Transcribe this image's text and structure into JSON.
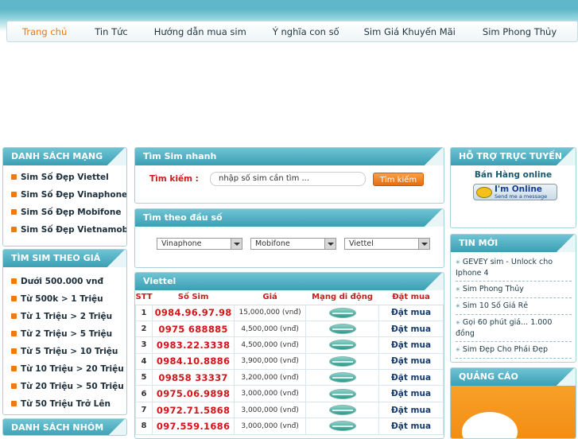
{
  "nav": {
    "items": [
      "Trang chủ",
      "Tin Tức",
      "Hướng dẫn mua sim",
      "Ý nghĩa con số",
      "Sim Giá Khuyến Mãi",
      "Sim Phong Thủy"
    ]
  },
  "left": {
    "networks_title": "DANH SÁCH MẠNG",
    "networks": [
      "Sim Số Đẹp Viettel",
      "Sim Số Đẹp Vinaphone",
      "Sim Số Đẹp Mobifone",
      "Sim Số Đẹp Vietnamobile"
    ],
    "price_title": "TÌM SIM THEO GIÁ",
    "prices": [
      "Dưới 500.000 vnđ",
      "Từ 500k > 1 Triệu",
      "Từ 1 Triệu > 2 Triệu",
      "Từ 2 Triệu > 5 Triệu",
      "Từ 5 Triệu > 10 Triệu",
      "Từ 10 Triệu > 20 Triệu",
      "Từ 20 Triệu > 50 Triệu",
      "Từ 50 Triệu Trở Lên"
    ],
    "group_title": "DANH SÁCH NHÓM"
  },
  "search": {
    "title": "Tìm Sim nhanh",
    "label": "Tìm kiếm :",
    "placeholder": "nhập số sim cần tìm ...",
    "button": "Tìm kiếm"
  },
  "prefix": {
    "title": "Tìm theo đầu số",
    "selects": [
      "Vinaphone",
      "Mobifone",
      "Viettel"
    ]
  },
  "table": {
    "title": "Viettel",
    "headers": [
      "STT",
      "Số Sim",
      "Giá",
      "Mạng di động",
      "Đặt mua"
    ],
    "rows": [
      {
        "stt": "1",
        "num": "0984.96.97.98",
        "price": "15,000,000 (vnđ)",
        "buy": "Đặt mua"
      },
      {
        "stt": "2",
        "num": "0975 688885",
        "price": "4,500,000 (vnđ)",
        "buy": "Đặt mua"
      },
      {
        "stt": "3",
        "num": "0983.22.3338",
        "price": "4,500,000 (vnđ)",
        "buy": "Đặt mua"
      },
      {
        "stt": "4",
        "num": "0984.10.8886",
        "price": "3,900,000 (vnđ)",
        "buy": "Đặt mua"
      },
      {
        "stt": "5",
        "num": "09858 33337",
        "price": "3,200,000 (vnđ)",
        "buy": "Đặt mua"
      },
      {
        "stt": "6",
        "num": "0975.06.9898",
        "price": "3,000,000 (vnđ)",
        "buy": "Đặt mua"
      },
      {
        "stt": "7",
        "num": "0972.71.5868",
        "price": "3,000,000 (vnđ)",
        "buy": "Đặt mua"
      },
      {
        "stt": "8",
        "num": "097.559.1686",
        "price": "3,000,000 (vnđ)",
        "buy": "Đặt mua"
      }
    ]
  },
  "right": {
    "support_title": "HỖ TRỢ TRỰC TUYẾN",
    "support_name": "Bán Hàng online",
    "im_main": "I'm Online",
    "im_sub": "Send me a message",
    "news_title": "TIN MỚI",
    "news": [
      "GEVEY sim - Unlock cho Iphone 4",
      "Sim Phong Thủy",
      "Sim 10 Số Giá Rẻ",
      "Gọi 60 phút giá... 1.000 đồng",
      "Sim Đẹp Cho Phái Đẹp"
    ],
    "ads_title": "QUẢNG CÁO"
  },
  "colors": {
    "accent": "#3b9fb4",
    "orange": "#f07a12",
    "red": "#cc1c1c"
  }
}
